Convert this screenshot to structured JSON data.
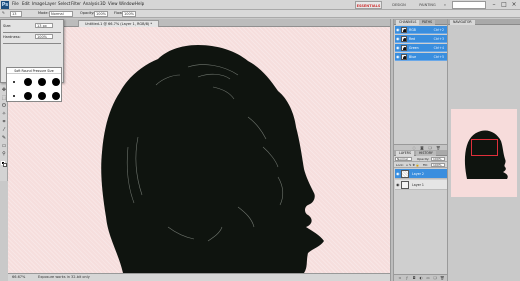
{
  "app": {
    "logo": "Ps"
  },
  "menu": [
    "File",
    "Edit",
    "Image",
    "Layer",
    "Select",
    "Filter",
    "Analysis",
    "3D",
    "View",
    "Window",
    "Help"
  ],
  "workspace": {
    "essentials": "ESSENTIALS",
    "design": "DESIGN",
    "painting": "PAINTING",
    "more": "»",
    "search_placeholder": ""
  },
  "window_controls": {
    "minimize": "–",
    "restore": "□",
    "close": "×"
  },
  "options_bar": {
    "brush_size": "13",
    "mode_label": "Mode:",
    "mode_value": "Normal",
    "opacity_label": "Opacity:",
    "opacity_value": "100%",
    "flow_label": "Flow:",
    "flow_value": "100%"
  },
  "brush_popup": {
    "size_label": "Size:",
    "size_value": "13 px",
    "hardness_label": "Hardness:",
    "hardness_value": "100%",
    "preset_title": "Soft Round Pressure Size",
    "presets_count": 12
  },
  "document": {
    "tab_title": "Untitled-1 @ 66.7% (Layer 1, RGB/8) *"
  },
  "status": {
    "zoom": "66.67%",
    "doc_info": "Exposure works in 32-bit only"
  },
  "channels_panel": {
    "tabs": [
      "CHANNELS",
      "PATHS"
    ],
    "channels": [
      {
        "name": "RGB",
        "key": "Ctrl+2"
      },
      {
        "name": "Red",
        "key": "Ctrl+3"
      },
      {
        "name": "Green",
        "key": "Ctrl+4"
      },
      {
        "name": "Blue",
        "key": "Ctrl+5"
      }
    ]
  },
  "layers_panel": {
    "tabs": [
      "LAYERS",
      "HISTORY"
    ],
    "blend_mode": "Normal",
    "opacity_label": "Opacity:",
    "opacity_value": "100%",
    "lock_label": "Lock:",
    "fill_label": "Fill:",
    "fill_value": "100%",
    "layers": [
      {
        "name": "Layer 2",
        "active": true
      },
      {
        "name": "Layer 1",
        "active": false
      }
    ]
  },
  "navigator_panel": {
    "tabs": [
      "NAVIGATOR"
    ]
  },
  "colors": {
    "canvas_bg": "#f6dedd",
    "selection_blue": "#3a8ede",
    "navigator_frame": "#e0303b",
    "silhouette": "#0f140f"
  }
}
